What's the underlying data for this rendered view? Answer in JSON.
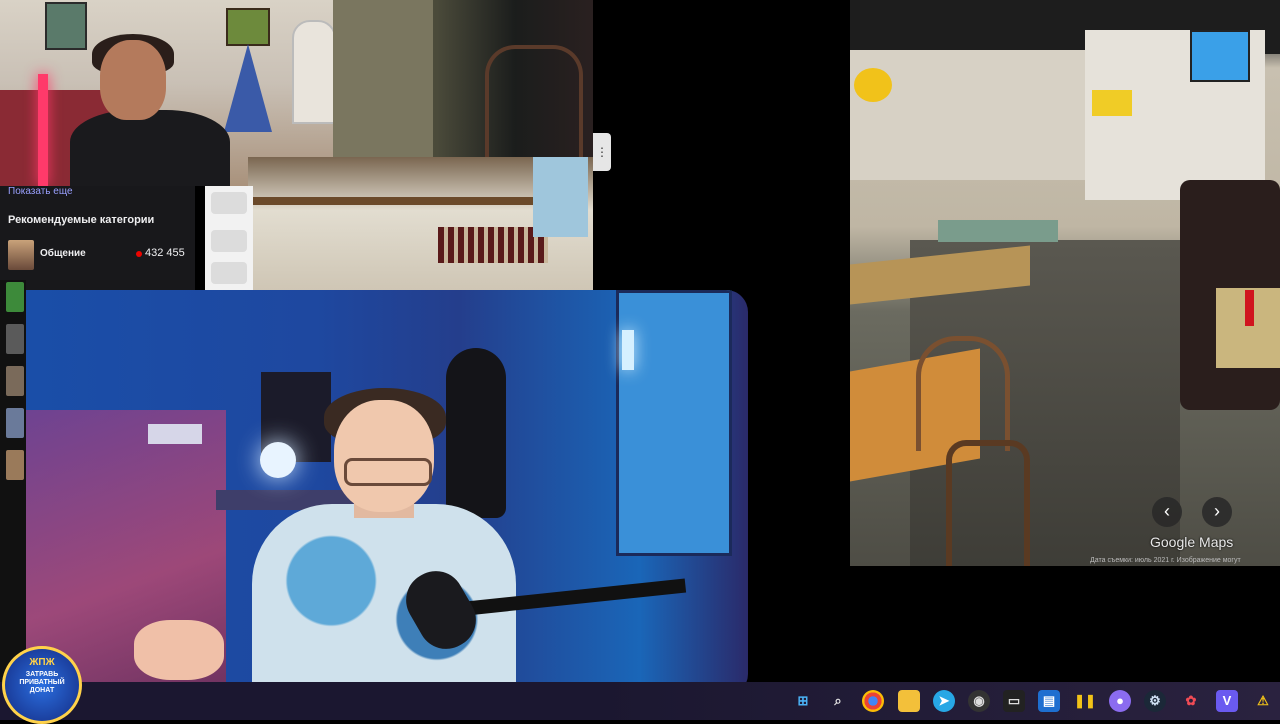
{
  "sidebar": {
    "more_link": "Показать еще",
    "heading": "Рекомендуемые категории",
    "categories": [
      {
        "name": "Общение",
        "viewers": "432 455"
      }
    ]
  },
  "maps": {
    "attribution": "Google Maps",
    "footer": "Дата съемки: июль 2021 г.   Изображение могут",
    "prev_icon": "‹",
    "next_icon": "›"
  },
  "badge": {
    "top": "ЖПЖ",
    "text": "ЗАТРАВЬ ПРИВАТНЫЙ ДОНАТ"
  },
  "taskbar": {
    "icons": [
      "windows-icon",
      "search-icon",
      "chrome-icon",
      "explorer-icon",
      "telegram-icon",
      "obs-icon",
      "terminal-icon",
      "edge-icon",
      "pause-icon",
      "discord-icon",
      "steam-icon",
      "settings-icon",
      "vpn-icon",
      "warning-icon"
    ]
  }
}
